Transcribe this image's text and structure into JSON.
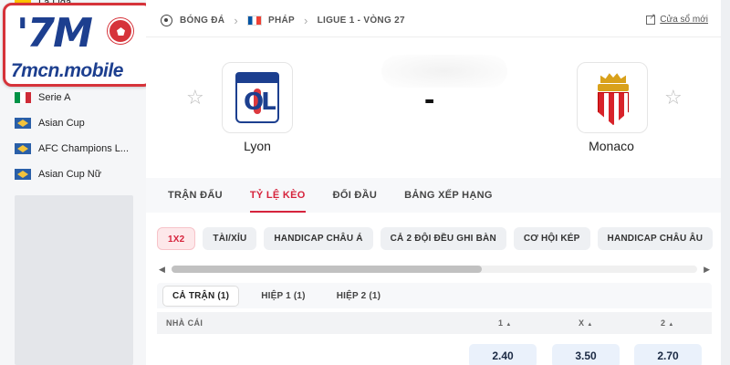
{
  "logo": {
    "mark": "'7M",
    "text": "7mcn.mobile"
  },
  "sidebar": {
    "items": [
      {
        "label": "La Liga",
        "flag": "spain-flag"
      },
      {
        "label": "Serie A",
        "flag": "italy-flag"
      },
      {
        "label": "Asian Cup",
        "flag": "afc-flag"
      },
      {
        "label": "AFC Champions L...",
        "flag": "afc-flag"
      },
      {
        "label": "Asian Cup Nữ",
        "flag": "afc-flag"
      }
    ]
  },
  "breadcrumb": {
    "sport": "BÓNG ĐÁ",
    "country": "PHÁP",
    "competition": "LIGUE 1 - VÒNG 27"
  },
  "popout_label": "Cửa sổ mới",
  "match": {
    "home": {
      "name": "Lyon",
      "crest_text": "OL"
    },
    "away": {
      "name": "Monaco"
    },
    "score": "-"
  },
  "tabs": [
    {
      "label": "TRẬN ĐẤU",
      "active": false
    },
    {
      "label": "TỶ LỆ KÈO",
      "active": true
    },
    {
      "label": "ĐỐI ĐẦU",
      "active": false
    },
    {
      "label": "BẢNG XẾP HẠNG",
      "active": false
    }
  ],
  "markets": [
    {
      "label": "1X2",
      "active": true
    },
    {
      "label": "TÀI/XỈU",
      "active": false
    },
    {
      "label": "HANDICAP CHÂU Á",
      "active": false
    },
    {
      "label": "CẢ 2 ĐỘI ĐỀU GHI BÀN",
      "active": false
    },
    {
      "label": "CƠ HỘI KÉP",
      "active": false
    },
    {
      "label": "HANDICAP CHÂU ÂU",
      "active": false
    }
  ],
  "scroll": {
    "thumb_fraction": 0.59
  },
  "periods": [
    {
      "label": "CẢ TRẬN (1)",
      "active": true
    },
    {
      "label": "HIỆP 1 (1)",
      "active": false
    },
    {
      "label": "HIỆP 2 (1)",
      "active": false
    }
  ],
  "odds_table": {
    "headers": {
      "bookmaker": "NHÀ CÁI",
      "home": "1",
      "draw": "X",
      "away": "2"
    },
    "sort_icon": "▲",
    "rows": [
      {
        "home": "2.40",
        "draw": "3.50",
        "away": "2.70"
      }
    ]
  },
  "colors": {
    "accent": "#d6233c",
    "brand_blue": "#1d3f8f",
    "brand_red": "#d6333a"
  }
}
